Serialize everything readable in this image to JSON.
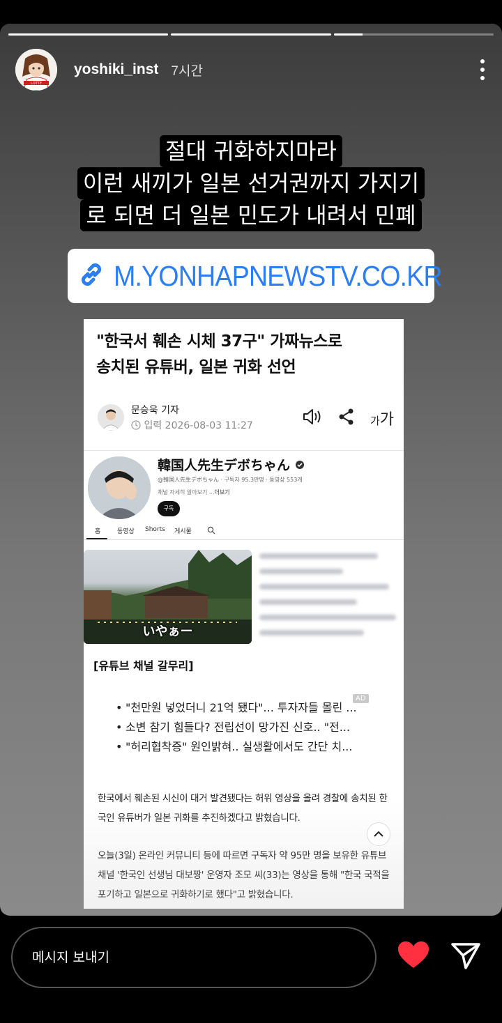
{
  "story": {
    "progress": [
      1,
      1,
      0.18
    ],
    "username": "yoshiki_inst",
    "time": "7시간",
    "caption_lines": [
      "절대 귀화하지마라",
      "이런 새끼가 일본 선거권까지 가지기",
      "로 되면 더 일본 민도가 내려서 민폐"
    ],
    "link": "M.YONHAPNEWSTV.CO.KR",
    "avatar_text": "LOTTE"
  },
  "article": {
    "headline_line1": "\"한국서 훼손 시체 37구\" 가짜뉴스로",
    "headline_line2": "송치된 유튜버, 일본 귀화 선언",
    "reporter": "문승욱 기자",
    "date": "입력 2026-08-03 11:27",
    "font_big": "가",
    "font_small": "가",
    "youtube": {
      "title": "韓国人先生デボちゃん",
      "handle": "@韓国人先生デボちゃん · 구독자 95.3만명 · 동영상 553개",
      "desc_prefix": "채널 자세히 알아보기 ...",
      "desc_more": "더보기",
      "subscribe": "구독",
      "tabs": [
        "홈",
        "동영상",
        "Shorts",
        "게시물"
      ],
      "thumb_caption": "いやぁー"
    },
    "section_title": "[유튜브 채널 갈무리]",
    "ad": "AD",
    "related": [
      "\"천만원 넣었더니 21억 됐다\"... 투자자들 몰린 ...",
      "소변 참기 힘들다? 전립선이 망가진 신호.. \"전...",
      "\"허리협착증\" 원인밝혀.. 실생활에서도 간단 치..."
    ],
    "para1_line1": "한국에서 훼손된 시신이 대거 발견됐다는 허위 영상을 올려 경찰에 송치된 한",
    "para1_line2": "국인 유튜버가 일본 귀화를 추진하겠다고 밝혔습니다.",
    "para2_line1": "오늘(3일) 온라인 커뮤니티 등에 따르면 구독자 약 95만 명을 보유한 유튜브",
    "para2_line2": "채널 '한국인 선생님 대보짱' 운영자 조모 씨(33)는 영상을 통해 \"한국 국적을",
    "para2_line3": "포기하고 일본으로 귀화하기로 했다\"고 밝혔습니다."
  },
  "bottom": {
    "message_placeholder": "메시지 보내기",
    "heart_color": "#ff3040"
  }
}
